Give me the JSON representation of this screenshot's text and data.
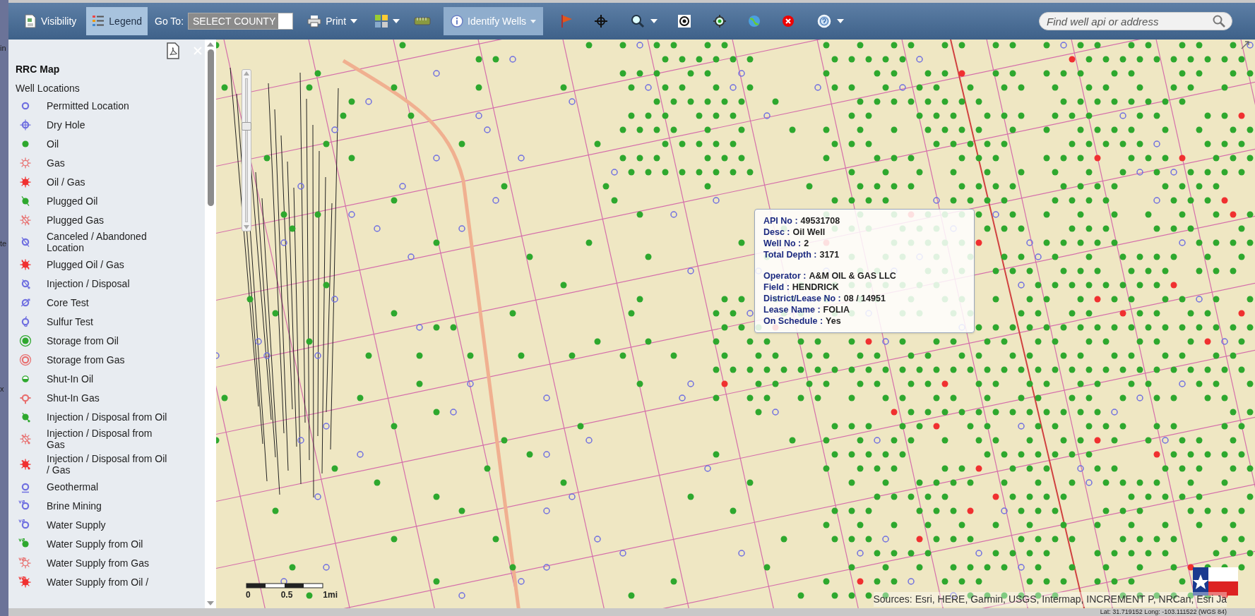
{
  "background_window": {
    "texts": [
      "in",
      "te",
      "x"
    ]
  },
  "toolbar": {
    "visibility_button": {
      "label": "Visibility",
      "selected": false
    },
    "legend_button": {
      "label": "Legend",
      "selected": true
    },
    "goto_label": "Go To:",
    "county_select": {
      "value": "SELECT COUNTY"
    },
    "print_button": {
      "label": "Print"
    },
    "identify_button": {
      "label": "Identify Wells",
      "selected": true
    },
    "search": {
      "placeholder": "Find well api or address"
    }
  },
  "legend": {
    "title": "RRC Map",
    "group": "Well Locations",
    "items": [
      {
        "label": "Permitted Location",
        "kind": "ring",
        "color": "#7070e0"
      },
      {
        "label": "Dry Hole",
        "kind": "crosshair",
        "color": "#7070e0"
      },
      {
        "label": "Oil",
        "kind": "dot",
        "color": "#2ea82e"
      },
      {
        "label": "Gas",
        "kind": "sun",
        "color": "#e87070"
      },
      {
        "label": "Oil / Gas",
        "kind": "sunfill",
        "color": "#f03030"
      },
      {
        "label": "Plugged Oil",
        "kind": "dotslash",
        "color": "#2ea82e"
      },
      {
        "label": "Plugged Gas",
        "kind": "sunslash",
        "color": "#e87070"
      },
      {
        "label": "Canceled / Abandoned Location",
        "kind": "ringslash",
        "color": "#7070e0"
      },
      {
        "label": "Plugged Oil / Gas",
        "kind": "sunfillslash",
        "color": "#f03030"
      },
      {
        "label": "Injection / Disposal",
        "kind": "ringarrow",
        "color": "#7070e0"
      },
      {
        "label": "Core Test",
        "kind": "ringtick",
        "color": "#7070e0"
      },
      {
        "label": "Sulfur Test",
        "kind": "ringhook",
        "color": "#7070e0"
      },
      {
        "label": "Storage from Oil",
        "kind": "storage",
        "color": "#2ea82e"
      },
      {
        "label": "Storage from Gas",
        "kind": "storagering",
        "color": "#e87070"
      },
      {
        "label": "Shut-In Oil",
        "kind": "halfdot",
        "color": "#2ea82e"
      },
      {
        "label": "Shut-In Gas",
        "kind": "shutin",
        "color": "#e87070"
      },
      {
        "label": "Injection / Disposal from Oil",
        "kind": "dotarrow",
        "color": "#2ea82e"
      },
      {
        "label": "Injection / Disposal from Gas",
        "kind": "sunarrow",
        "color": "#e87070"
      },
      {
        "label": "Injection / Disposal from Oil / Gas",
        "kind": "sunfillarrow",
        "color": "#f03030"
      },
      {
        "label": "Geothermal",
        "kind": "geothermal",
        "color": "#7070e0"
      },
      {
        "label": "Brine Mining",
        "kind": "prefixring",
        "color": "#7070e0"
      },
      {
        "label": "Water Supply",
        "kind": "prefixring",
        "color": "#7070e0"
      },
      {
        "label": "Water Supply from Oil",
        "kind": "prefixdot",
        "color": "#2ea82e"
      },
      {
        "label": "Water Supply from Gas",
        "kind": "prefixsun",
        "color": "#e87070"
      },
      {
        "label": "Water Supply from Oil /",
        "kind": "prefixsunfill",
        "color": "#f03030"
      }
    ]
  },
  "map": {
    "zoom_slider": {
      "level": 0.67
    },
    "popup": {
      "sections": [
        [
          {
            "label": "API No :",
            "value": "49531708"
          },
          {
            "label": "Desc :",
            "value": "Oil Well"
          },
          {
            "label": "Well No :",
            "value": "2"
          },
          {
            "label": "Total Depth :",
            "value": "3171"
          }
        ],
        [
          {
            "label": "Operator :",
            "value": "A&M OIL & GAS LLC"
          },
          {
            "label": "Field :",
            "value": "HENDRICK"
          },
          {
            "label": "District/Lease No :",
            "value": "08 / 14951"
          },
          {
            "label": "Lease Name :",
            "value": "FOLIA"
          },
          {
            "label": "On Schedule :",
            "value": "Yes"
          }
        ]
      ]
    },
    "scale_bar": {
      "labels": [
        "0",
        "0.5",
        "1mi"
      ]
    },
    "attribution": "Sources: Esri, HERE, Garmin, USGS, Intermap, INCREMENT P, NRCan, Esri Ja"
  },
  "status_bar": {
    "coordinates": "Lat: 31.719152 Long: -103.111522 (WGS 84)"
  }
}
